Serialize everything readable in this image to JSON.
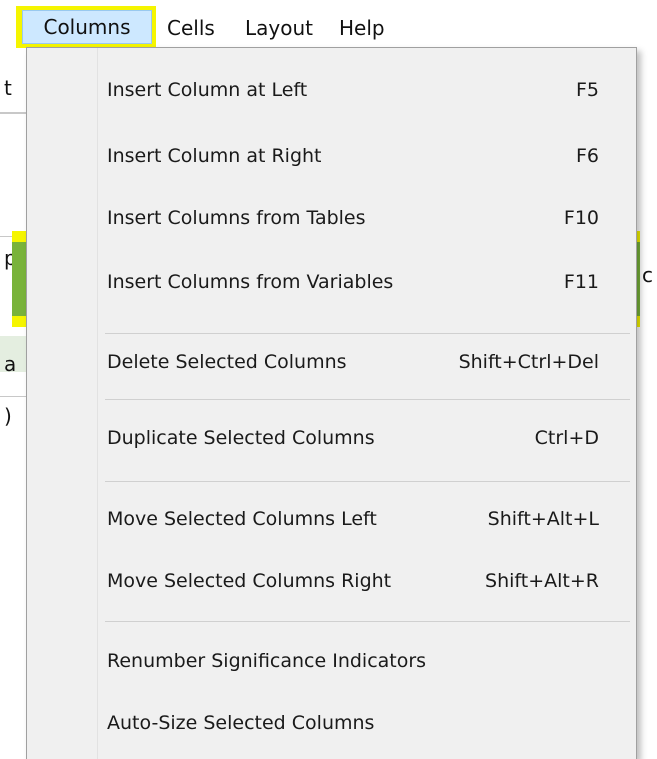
{
  "colors": {
    "annotation_yellow": "#f5f500",
    "selected_item_green": "#79b33a",
    "menu_background": "#f0f0f0",
    "active_menu_blue": "#cde8ff"
  },
  "menubar": {
    "items": [
      {
        "label": "Columns"
      },
      {
        "label": "Cells"
      },
      {
        "label": "Layout"
      },
      {
        "label": "Help"
      }
    ]
  },
  "dropdown": {
    "items": [
      {
        "label": "Insert Column at Left",
        "shortcut": "F5"
      },
      {
        "label": "Insert Column at Right",
        "shortcut": "F6"
      },
      {
        "label": "Insert Columns from Tables",
        "shortcut": "F10"
      },
      {
        "label": "Insert Columns from Variables",
        "shortcut": "F11"
      },
      {
        "label": "Delete Selected Columns",
        "shortcut": "Shift+Ctrl+Del"
      },
      {
        "label": "Duplicate Selected Columns",
        "shortcut": "Ctrl+D"
      },
      {
        "label": "Move Selected Columns Left",
        "shortcut": "Shift+Alt+L"
      },
      {
        "label": "Move Selected Columns Right",
        "shortcut": "Shift+Alt+R"
      },
      {
        "label": "Renumber Significance Indicators",
        "shortcut": ""
      },
      {
        "label": "Auto-Size Selected Columns",
        "shortcut": ""
      }
    ]
  },
  "background": {
    "fragments": [
      "t",
      "p",
      "a",
      ")",
      "c"
    ]
  }
}
